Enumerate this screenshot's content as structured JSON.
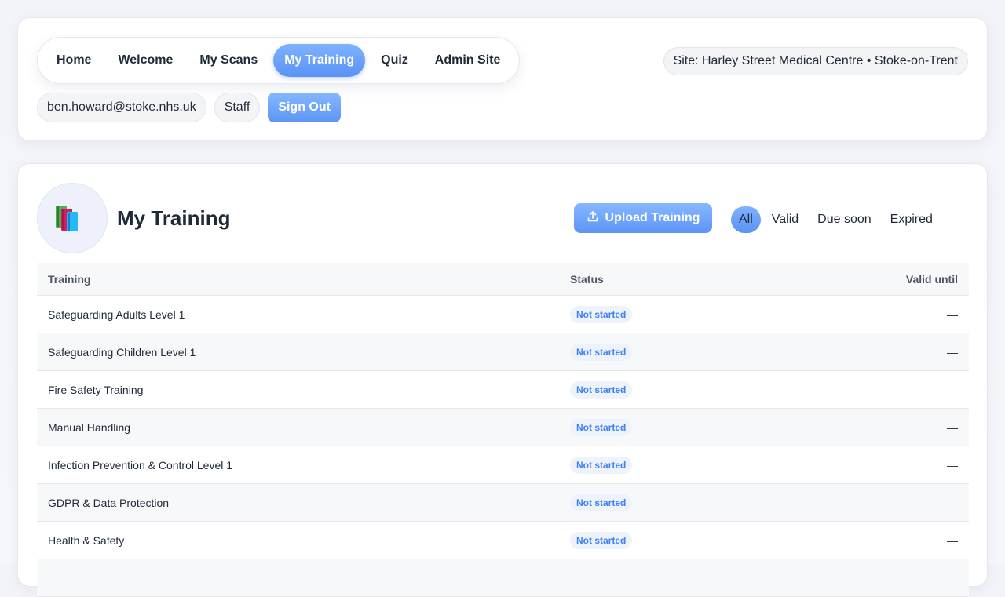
{
  "nav": {
    "items": [
      {
        "label": "Home",
        "active": false
      },
      {
        "label": "Welcome",
        "active": false
      },
      {
        "label": "My Scans",
        "active": false
      },
      {
        "label": "My Training",
        "active": true
      },
      {
        "label": "Quiz",
        "active": false
      },
      {
        "label": "Admin Site",
        "active": false
      }
    ]
  },
  "site": {
    "label": "Site: Harley Street Medical Centre • Stoke-on-Trent"
  },
  "user": {
    "email": "ben.howard@stoke.nhs.uk",
    "role": "Staff",
    "signout_label": "Sign Out"
  },
  "page": {
    "title": "My Training",
    "logo_icon": "books-icon",
    "upload_label": "Upload Training",
    "upload_icon": "upload-icon"
  },
  "filters": [
    {
      "label": "All",
      "active": true
    },
    {
      "label": "Valid",
      "active": false
    },
    {
      "label": "Due soon",
      "active": false
    },
    {
      "label": "Expired",
      "active": false
    }
  ],
  "table": {
    "headers": {
      "training": "Training",
      "status": "Status",
      "valid_until": "Valid until"
    },
    "rows": [
      {
        "training": "Safeguarding Adults Level 1",
        "status": "Not started",
        "valid_until": "—"
      },
      {
        "training": "Safeguarding Children Level 1",
        "status": "Not started",
        "valid_until": "—"
      },
      {
        "training": "Fire Safety Training",
        "status": "Not started",
        "valid_until": "—"
      },
      {
        "training": "Manual Handling",
        "status": "Not started",
        "valid_until": "—"
      },
      {
        "training": "Infection Prevention & Control Level 1",
        "status": "Not started",
        "valid_until": "—"
      },
      {
        "training": "GDPR & Data Protection",
        "status": "Not started",
        "valid_until": "—"
      },
      {
        "training": "Health & Safety",
        "status": "Not started",
        "valid_until": "—"
      },
      {
        "training": "",
        "status": "",
        "valid_until": ""
      }
    ]
  },
  "colors": {
    "accent": "#5a93f5",
    "badge_text": "#3b82f6",
    "badge_bg": "#eef2fb"
  }
}
